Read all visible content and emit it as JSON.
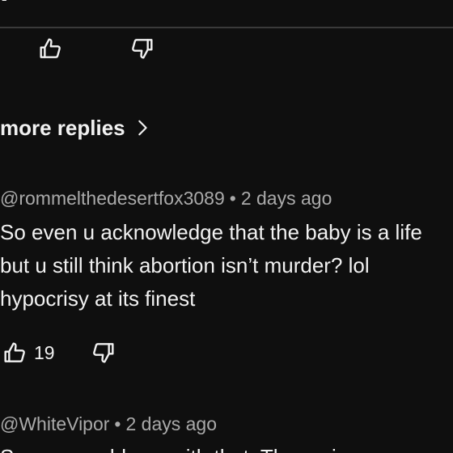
{
  "top_partial_text": "p",
  "previous_comment": {},
  "more_replies": {
    "label": "more replies"
  },
  "comments": [
    {
      "author": "@rommelthedesertfox3089",
      "separator": "•",
      "time": "2 days ago",
      "lines": [
        "So even u acknowledge that the baby is a life",
        "but u still think abortion isn’t murder? lol",
        "hypocrisy at its finest"
      ],
      "likes": "19"
    },
    {
      "author": "@WhiteVipor",
      "separator": "•",
      "time": "2 days ago",
      "partial_line": "So you would say with that. The main"
    }
  ],
  "icons": {
    "like": "thumbs-up-icon",
    "dislike": "thumbs-down-icon",
    "chevron": "chevron-right-icon"
  },
  "colors": {
    "background": "#0f0f0f",
    "text_primary": "#f1f1f1",
    "text_secondary": "#aaaaaa",
    "divider": "#3a3a3a"
  }
}
